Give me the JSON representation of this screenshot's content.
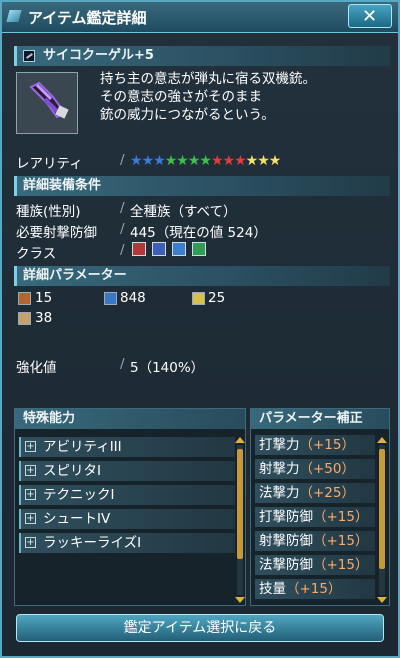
{
  "window": {
    "title": "アイテム鑑定詳細",
    "close_icon": "close-icon"
  },
  "item": {
    "name": "サイコクーゲル+5",
    "description": [
      "持ち主の意志が弾丸に宿る双機銃。",
      "その意志の強さがそのまま",
      "銃の威力につながるという。"
    ]
  },
  "rarity": {
    "label": "レアリティ",
    "stars": 13,
    "star_colors": [
      "#3a7be0",
      "#3a7be0",
      "#3a7be0",
      "#3fbf4a",
      "#3fbf4a",
      "#3fbf4a",
      "#3fbf4a",
      "#e83a3a",
      "#e83a3a",
      "#e83a3a",
      "#f4e06a",
      "#f4e06a",
      "#f4e06a"
    ]
  },
  "requirements": {
    "header": "詳細装備条件",
    "race_label": "種族(性別)",
    "race_value": "全種族（すべて）",
    "def_label": "必要射撃防御",
    "def_value": "445（現在の値 524）",
    "class_label": "クラス",
    "classes": [
      "hunter-icon",
      "ranger-icon",
      "gunner-icon",
      "force-icon"
    ]
  },
  "parameters": {
    "header": "詳細パラメーター",
    "values": [
      {
        "icon": "hammer-icon",
        "value": "15"
      },
      {
        "icon": "weapon-icon",
        "value": "848"
      },
      {
        "icon": "magnify-icon",
        "value": "25"
      },
      {
        "icon": "element-icon",
        "value": "38"
      }
    ]
  },
  "grind": {
    "label": "強化値",
    "value": "5（140%）"
  },
  "special": {
    "header": "特殊能力",
    "abilities": [
      "アビリティIII",
      "スピリタI",
      "テクニックI",
      "シュートIV",
      "ラッキーライズI"
    ]
  },
  "param_bonus": {
    "header": "パラメーター補正",
    "items": [
      {
        "name": "打撃力",
        "value": "（+15）"
      },
      {
        "name": "射撃力",
        "value": "（+50）"
      },
      {
        "name": "法撃力",
        "value": "（+25）"
      },
      {
        "name": "打撃防御",
        "value": "（+15）"
      },
      {
        "name": "射撃防御",
        "value": "（+15）"
      },
      {
        "name": "法撃防御",
        "value": "（+15）"
      },
      {
        "name": "技量",
        "value": "（+15）"
      }
    ]
  },
  "footer": {
    "back_label": "鑑定アイテム選択に戻る"
  }
}
